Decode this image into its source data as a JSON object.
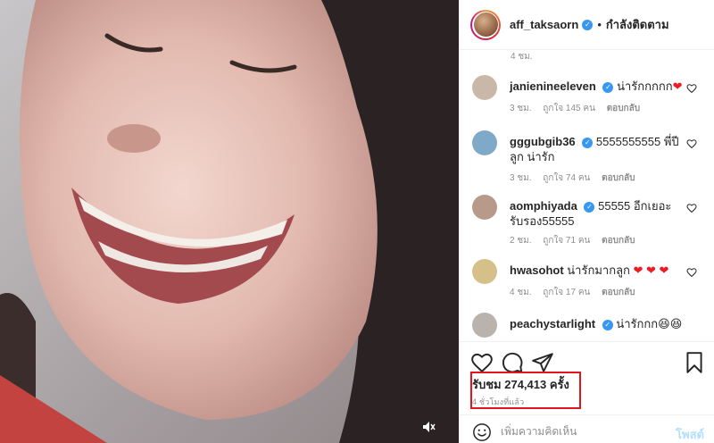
{
  "header": {
    "username": "aff_taksaorn",
    "following_label": "กำลังติดตาม",
    "separator": "•"
  },
  "comments": {
    "partial_meta": "4 ชม.",
    "items": [
      {
        "username": "janienineeleven",
        "verified": true,
        "text": "น่ารักกกกก",
        "emoji": "❤",
        "time": "3 ชม.",
        "likes": "ถูกใจ 145 คน",
        "reply": "ตอบกลับ",
        "avatar_color": "#c9b7a7"
      },
      {
        "username": "gggubgib36",
        "verified": true,
        "text": "5555555555 พี่ปีลูก น่ารัก",
        "emoji": "",
        "time": "3 ชม.",
        "likes": "ถูกใจ 74 คน",
        "reply": "ตอบกลับ",
        "avatar_color": "#7fa9c8"
      },
      {
        "username": "aomphiyada",
        "verified": true,
        "text": "55555 อีกเยอะ รับรอง55555",
        "emoji": "",
        "time": "2 ชม.",
        "likes": "ถูกใจ 71 คน",
        "reply": "ตอบกลับ",
        "avatar_color": "#b79a8a"
      },
      {
        "username": "hwasohot",
        "verified": false,
        "text": "น่ารักมากลูก",
        "emoji": "❤ ❤ ❤",
        "time": "4 ชม.",
        "likes": "ถูกใจ 17 คน",
        "reply": "ตอบกลับ",
        "avatar_color": "#d6c08a"
      },
      {
        "username": "peachystarlight",
        "verified": true,
        "text": "น่ารักกก",
        "emoji": "😆😆",
        "time": "",
        "likes": "",
        "reply": "",
        "avatar_color": "#b9b2ad"
      }
    ]
  },
  "stats": {
    "views": "รับชม 274,413 ครั้ง",
    "time_ago": "4 ชั่วโมงที่แล้ว"
  },
  "composer": {
    "placeholder": "เพิ่มความคิดเห็น",
    "post_label": "โพสต์"
  },
  "icons": {
    "like": "heart-icon",
    "comment": "comment-icon",
    "share": "share-icon",
    "save": "bookmark-icon",
    "mute": "mute-icon",
    "emoji": "emoji-icon"
  },
  "colors": {
    "verified": "#3897f0",
    "highlight_border": "#e0161b",
    "post_button_disabled": "#b2dffc",
    "heart": "#ed1c24"
  }
}
